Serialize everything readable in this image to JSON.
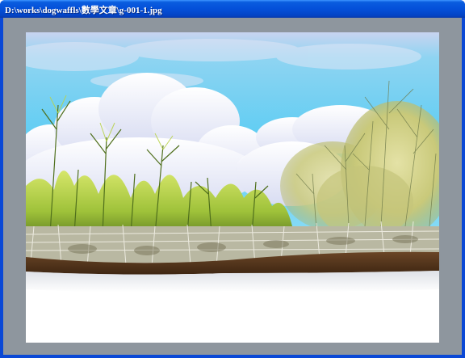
{
  "window": {
    "title": "D:\\works\\dogwaffls\\數學文章\\g-001-1.jpg"
  },
  "image": {
    "subject": "painted landscape: blue sky with white clouds, green pine-like shrubs, feathery grass, frosty grass strip over brown soil, white ground",
    "colors": {
      "frame": "#0a48d6",
      "titlebar": "#0450d9",
      "client_background": "#8e969e",
      "sky": "#6fd0f2",
      "soil": "#5a3a22",
      "ground": "#ffffff"
    }
  }
}
